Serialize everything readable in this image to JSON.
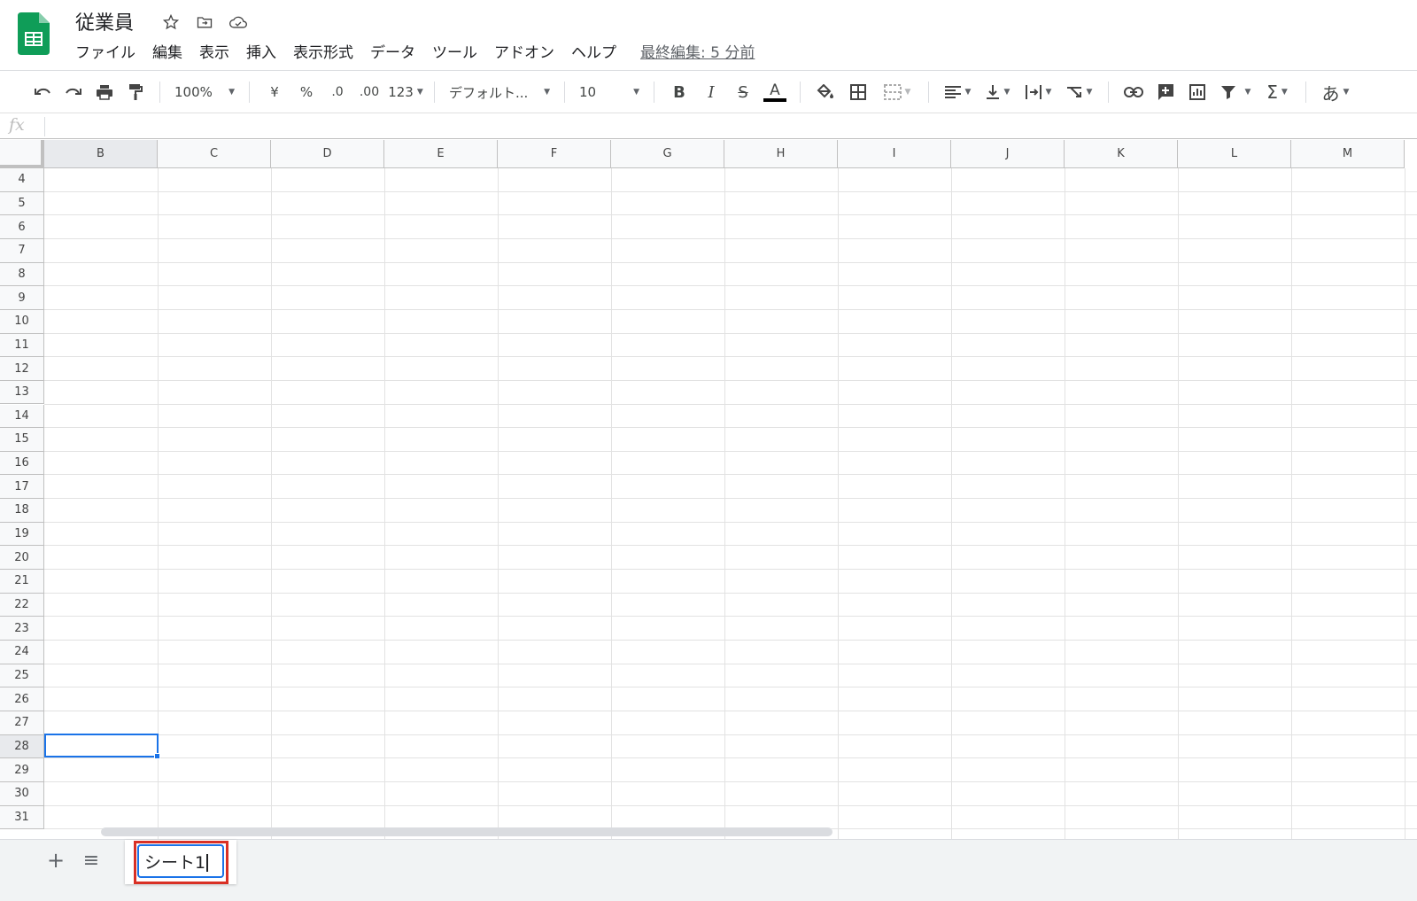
{
  "doc": {
    "title": "従業員",
    "last_edit": "最終編集: 5 分前"
  },
  "menu": [
    "ファイル",
    "編集",
    "表示",
    "挿入",
    "表示形式",
    "データ",
    "ツール",
    "アドオン",
    "ヘルプ"
  ],
  "toolbar": {
    "zoom": "100%",
    "currency": "¥",
    "percent": "%",
    "decrease_decimals": ".0",
    "increase_decimals": ".00",
    "more_formats": "123",
    "font": "デフォルト...",
    "font_size": "10",
    "bold": "B",
    "italic": "I",
    "strike": "S",
    "text_color": "A",
    "sum": "Σ",
    "input_tools": "あ"
  },
  "formula_bar": {
    "fx": "fx",
    "value": ""
  },
  "columns": [
    "B",
    "C",
    "D",
    "E",
    "F",
    "G",
    "H",
    "I",
    "J",
    "K",
    "L",
    "M"
  ],
  "rows": [
    "4",
    "5",
    "6",
    "7",
    "8",
    "9",
    "10",
    "11",
    "12",
    "13",
    "14",
    "15",
    "16",
    "17",
    "18",
    "19",
    "20",
    "21",
    "22",
    "23",
    "24",
    "25",
    "26",
    "27",
    "28",
    "29",
    "30",
    "31"
  ],
  "selected_cell": {
    "column": "B",
    "row": "28"
  },
  "sheets": {
    "add": "+",
    "list": "≡",
    "rename_value": "シート1"
  },
  "colors": {
    "accent": "#1a73e8",
    "highlight": "#d93025",
    "sheets_green": "#0f9d58"
  }
}
